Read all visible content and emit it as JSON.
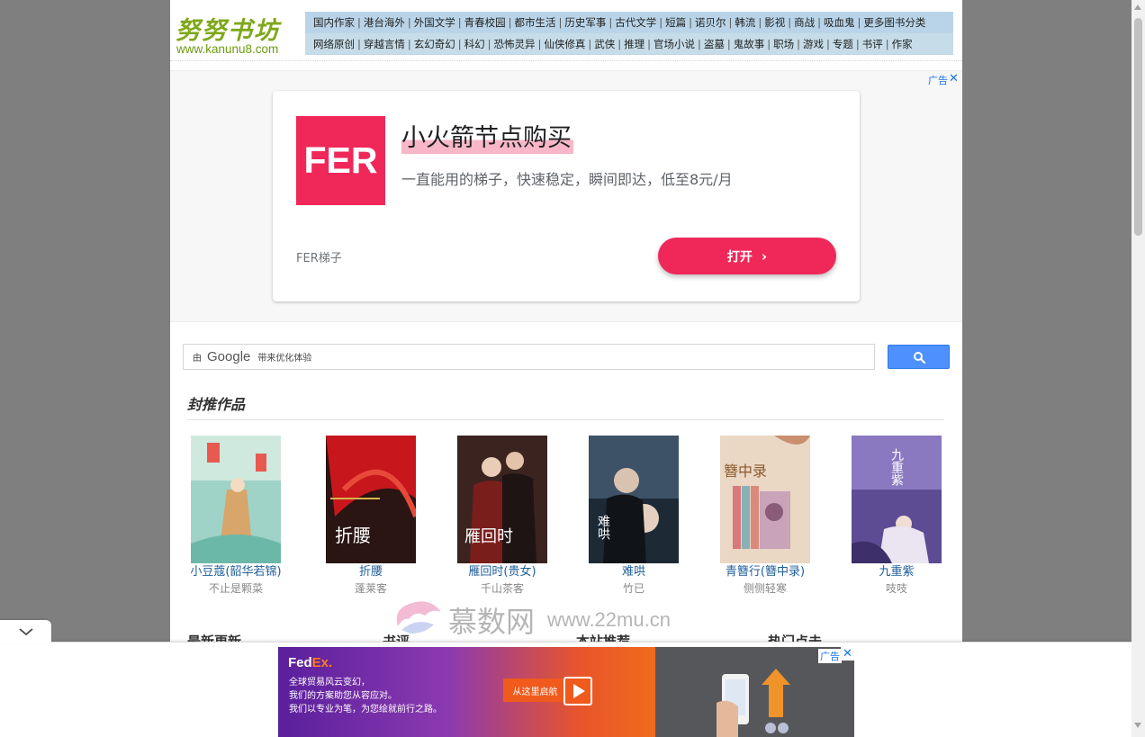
{
  "logo": {
    "name": "努努书坊",
    "url": "www.kanunu8.com"
  },
  "nav": {
    "row1": [
      "国内作家",
      "港台海外",
      "外国文学",
      "青春校园",
      "都市生活",
      "历史军事",
      "古代文学",
      "短篇",
      "诺贝尔",
      "韩流",
      "影视",
      "商战",
      "吸血鬼",
      "更多图书分类"
    ],
    "row2": [
      "网络原创",
      "穿越言情",
      "玄幻奇幻",
      "科幻",
      "恐怖灵异",
      "仙侠修真",
      "武侠",
      "推理",
      "官场小说",
      "盗墓",
      "鬼故事",
      "职场",
      "游戏",
      "专题",
      "书评",
      "作家"
    ]
  },
  "ad_top": {
    "label": "广告",
    "close": "✕",
    "logo_text": "FER",
    "title": "小火箭节点购买",
    "desc": "一直能用的梯子，快速稳定，瞬间即达，低至8元/月",
    "brand": "FER梯子",
    "button": "打开",
    "button_chevron": "›",
    "brand_color": "#f0285a"
  },
  "search": {
    "by": "由",
    "provider": "Google",
    "hint": "带来优化体验",
    "button_icon": "search-icon"
  },
  "featured": {
    "title": "封推作品",
    "books": [
      {
        "title": "小豆蔻(韶华若锦)",
        "author": "不止是颗菜"
      },
      {
        "title": "折腰",
        "author": "蓬莱客",
        "cover_text": "折腰"
      },
      {
        "title": "雁回时(贵女)",
        "author": "千山茶客",
        "cover_text": "雁回时"
      },
      {
        "title": "难哄",
        "author": "竹已",
        "cover_text": "难哄"
      },
      {
        "title": "青簪行(簪中录)",
        "author": "侧侧轻寒",
        "cover_text": "簪中录"
      },
      {
        "title": "九重紫",
        "author": "吱吱",
        "cover_text": "九重紫"
      }
    ]
  },
  "sections_next": [
    "最新更新",
    "书评",
    "本站推荐",
    "热门点击"
  ],
  "watermark": {
    "text": "慕数网",
    "url": "www.22mu.cn"
  },
  "ad_bottom": {
    "label": "广告",
    "close": "✕",
    "brand": "FedEx",
    "brand_fed": "Fed",
    "brand_ex": "Ex.",
    "lines": [
      "全球贸易风云变幻，",
      "我们的方案助您从容应对。",
      "我们以专业为笔，为您绘就前行之路。"
    ],
    "cta": "从这里启航"
  }
}
